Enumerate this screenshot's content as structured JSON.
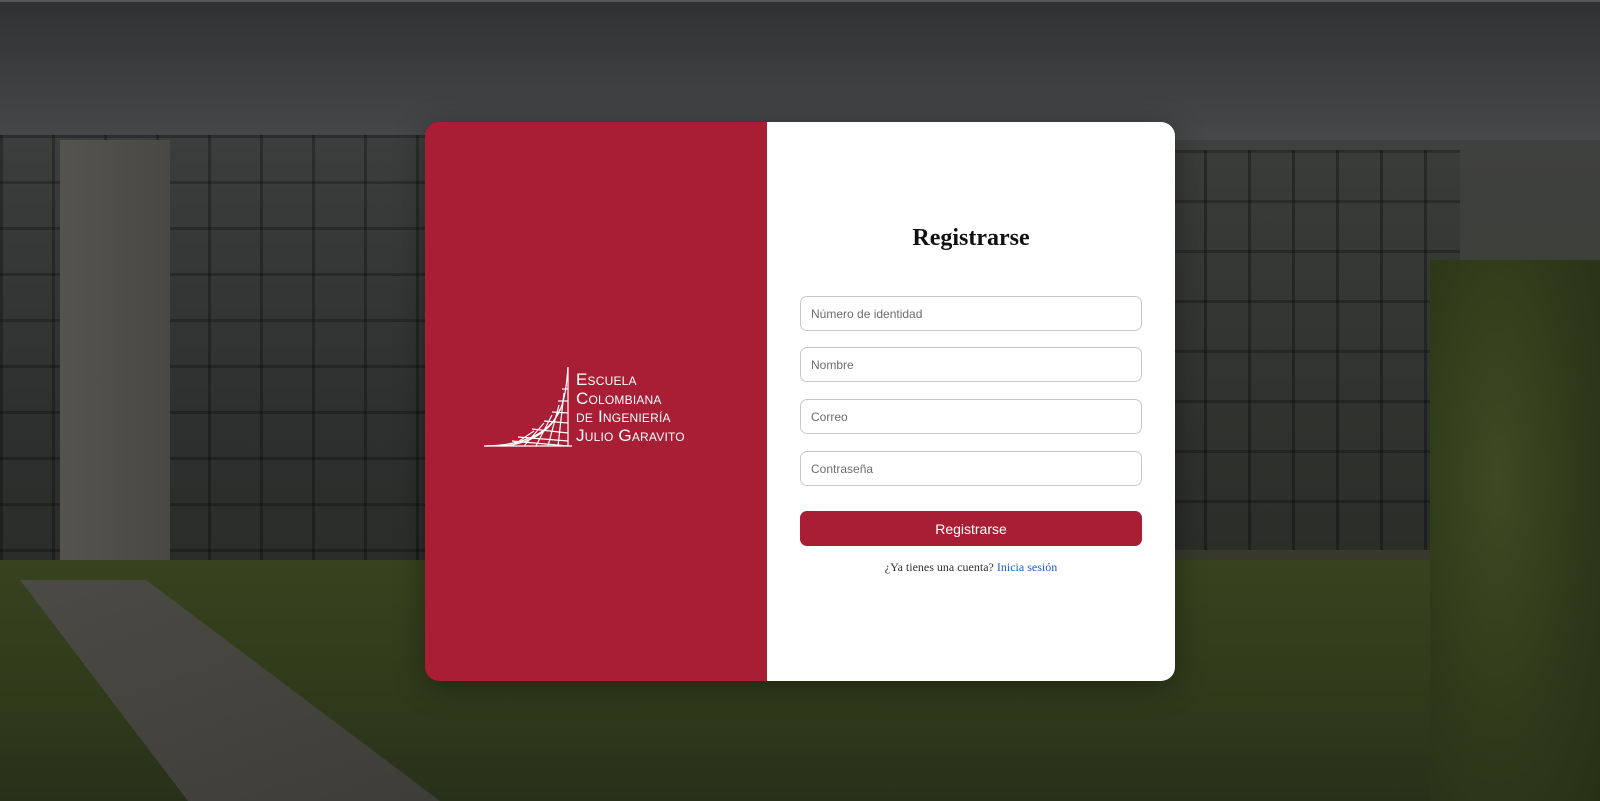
{
  "colors": {
    "brand_red": "#a81e34",
    "link_blue": "#1a5fd0"
  },
  "brand": {
    "logo_lines": [
      "Escuela",
      "Colombiana",
      "de Ingeniería",
      "Julio Garavito"
    ]
  },
  "form": {
    "title": "Registrarse",
    "fields": {
      "id_number_placeholder": "Número de identidad",
      "name_placeholder": "Nombre",
      "email_placeholder": "Correo",
      "password_placeholder": "Contraseña"
    },
    "submit_label": "Registrarse",
    "login_prompt": "¿Ya tienes una cuenta?",
    "login_link": "Inicia sesión"
  }
}
